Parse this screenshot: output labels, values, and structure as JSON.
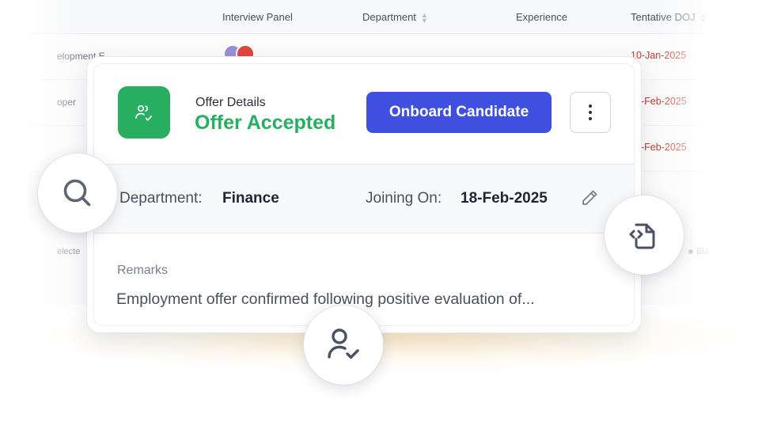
{
  "background_table": {
    "headers": {
      "interview_panel": "Interview Panel",
      "department": "Department",
      "experience": "Experience",
      "tentative_doj": "Tentative DOJ"
    },
    "rows": [
      {
        "role": "elopment E",
        "date": "10-Jan-2025"
      },
      {
        "role": "oper",
        "date": "-Feb-2025"
      },
      {
        "role": "",
        "date": "-Feb-2025"
      }
    ],
    "footer_left": "electe",
    "footer_right": "Blac"
  },
  "offer_card": {
    "label": "Offer Details",
    "status": "Offer Accepted",
    "primary_button": "Onboard Candidate",
    "more_icon": "more-vertical-icon",
    "department_label": "Department:",
    "department_value": "Finance",
    "joining_label": "Joining On:",
    "joining_value": "18-Feb-2025",
    "remarks_label": "Remarks",
    "remarks_text": "Employment offer confirmed following positive evaluation of..."
  },
  "floating_icons": [
    "search-icon",
    "code-file-icon",
    "user-check-icon"
  ],
  "colors": {
    "accent_green": "#27ae60",
    "primary_blue": "#3f4fe0",
    "date_red": "#c0392b"
  }
}
